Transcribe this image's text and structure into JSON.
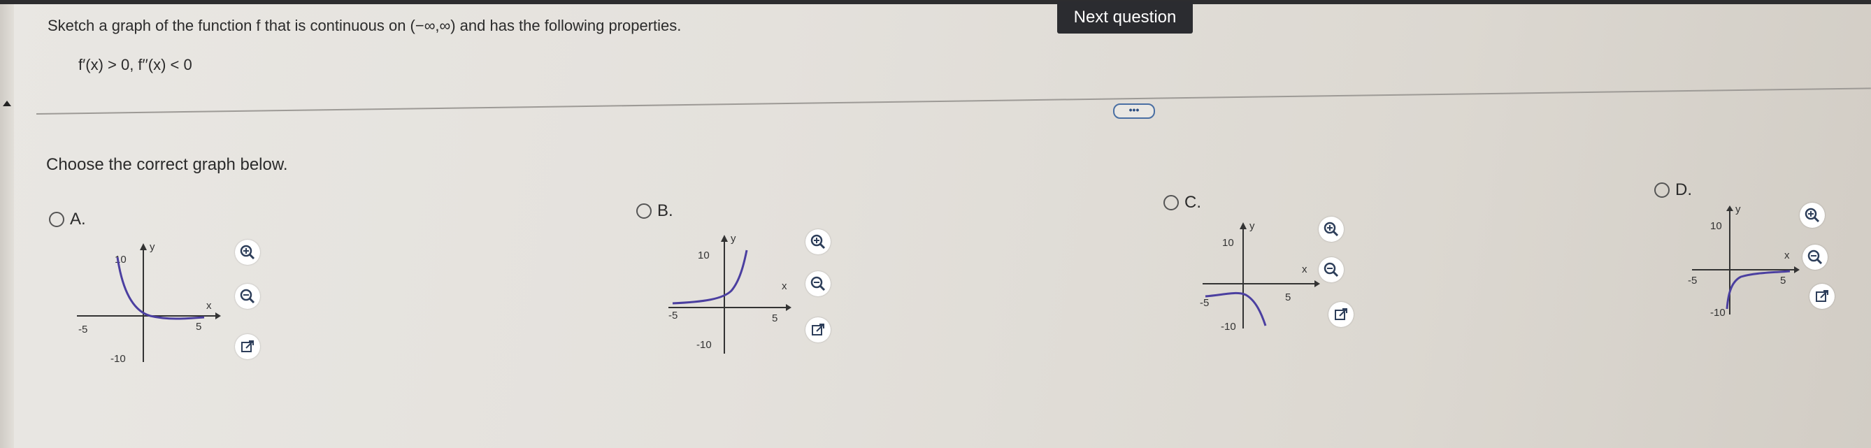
{
  "question": {
    "text": "Sketch a graph of the function f that is continuous on (−∞,∞) and has the following properties.",
    "properties": "f′(x) > 0, f′′(x) < 0"
  },
  "next_button": {
    "label": "Next question"
  },
  "more_button": {
    "label": "•••"
  },
  "prompt": "Choose the correct graph below.",
  "options": [
    {
      "label": "A.",
      "ticks": {
        "y_top": "10",
        "y_bottom": "-10",
        "x_left": "-5",
        "x_right": "5"
      },
      "axis_x": "x",
      "axis_y": "y"
    },
    {
      "label": "B.",
      "ticks": {
        "y_top": "10",
        "y_bottom": "-10",
        "x_left": "-5",
        "x_right": "5"
      },
      "axis_x": "x",
      "axis_y": "y"
    },
    {
      "label": "C.",
      "ticks": {
        "y_top": "10",
        "y_bottom": "-10",
        "x_left": "-5",
        "x_right": "5"
      },
      "axis_x": "x",
      "axis_y": "y"
    },
    {
      "label": "D.",
      "ticks": {
        "y_top": "10",
        "y_bottom": "-10",
        "x_left": "-5",
        "x_right": "5"
      },
      "axis_x": "x",
      "axis_y": "y"
    }
  ],
  "icons": {
    "zoom_in": "zoom-in-icon",
    "zoom_out": "zoom-out-icon",
    "popout": "popout-icon"
  },
  "colors": {
    "curve": "#4b3fa0",
    "button_bg": "#2b2c30"
  }
}
